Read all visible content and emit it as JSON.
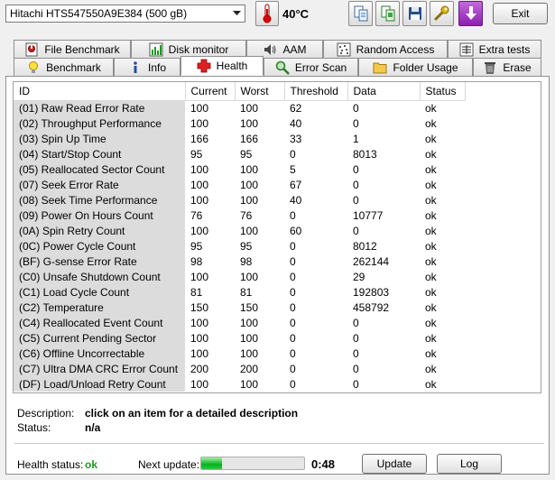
{
  "toolbar": {
    "drive_select": "Hitachi HTS547550A9E384 (500 gB)",
    "temperature": "40°C",
    "exit_label": "Exit"
  },
  "tabs_row1": [
    {
      "label": "File Benchmark",
      "icon": "file-benchmark-icon"
    },
    {
      "label": "Disk monitor",
      "icon": "disk-monitor-icon"
    },
    {
      "label": "AAM",
      "icon": "speaker-icon"
    },
    {
      "label": "Random Access",
      "icon": "random-access-icon"
    },
    {
      "label": "Extra tests",
      "icon": "extra-tests-icon"
    }
  ],
  "tabs_row2": [
    {
      "label": "Benchmark",
      "icon": "lightbulb-icon"
    },
    {
      "label": "Info",
      "icon": "info-icon"
    },
    {
      "label": "Health",
      "icon": "red-cross-icon",
      "active": true
    },
    {
      "label": "Error Scan",
      "icon": "magnifier-icon"
    },
    {
      "label": "Folder Usage",
      "icon": "folder-icon"
    },
    {
      "label": "Erase",
      "icon": "trash-icon"
    }
  ],
  "table": {
    "columns": [
      "ID",
      "Current",
      "Worst",
      "Threshold",
      "Data",
      "Status"
    ],
    "rows": [
      [
        "(01) Raw Read Error Rate",
        "100",
        "100",
        "62",
        "0",
        "ok"
      ],
      [
        "(02) Throughput Performance",
        "100",
        "100",
        "40",
        "0",
        "ok"
      ],
      [
        "(03) Spin Up Time",
        "166",
        "166",
        "33",
        "1",
        "ok"
      ],
      [
        "(04) Start/Stop Count",
        "95",
        "95",
        "0",
        "8013",
        "ok"
      ],
      [
        "(05) Reallocated Sector Count",
        "100",
        "100",
        "5",
        "0",
        "ok"
      ],
      [
        "(07) Seek Error Rate",
        "100",
        "100",
        "67",
        "0",
        "ok"
      ],
      [
        "(08) Seek Time Performance",
        "100",
        "100",
        "40",
        "0",
        "ok"
      ],
      [
        "(09) Power On Hours Count",
        "76",
        "76",
        "0",
        "10777",
        "ok"
      ],
      [
        "(0A) Spin Retry Count",
        "100",
        "100",
        "60",
        "0",
        "ok"
      ],
      [
        "(0C) Power Cycle Count",
        "95",
        "95",
        "0",
        "8012",
        "ok"
      ],
      [
        "(BF) G-sense Error Rate",
        "98",
        "98",
        "0",
        "262144",
        "ok"
      ],
      [
        "(C0) Unsafe Shutdown Count",
        "100",
        "100",
        "0",
        "29",
        "ok"
      ],
      [
        "(C1) Load Cycle Count",
        "81",
        "81",
        "0",
        "192803",
        "ok"
      ],
      [
        "(C2) Temperature",
        "150",
        "150",
        "0",
        "458792",
        "ok"
      ],
      [
        "(C4) Reallocated Event Count",
        "100",
        "100",
        "0",
        "0",
        "ok"
      ],
      [
        "(C5) Current Pending Sector",
        "100",
        "100",
        "0",
        "0",
        "ok"
      ],
      [
        "(C6) Offline Uncorrectable",
        "100",
        "100",
        "0",
        "0",
        "ok"
      ],
      [
        "(C7) Ultra DMA CRC Error Count",
        "200",
        "200",
        "0",
        "0",
        "ok"
      ],
      [
        "(DF) Load/Unload Retry Count",
        "100",
        "100",
        "0",
        "0",
        "ok"
      ]
    ]
  },
  "description": {
    "label": "Description:",
    "value": "click on an item for a detailed description",
    "status_label": "Status:",
    "status_value": "n/a"
  },
  "footer": {
    "health_label": "Health status:",
    "health_value": "ok",
    "next_update_label": "Next update:",
    "next_update_progress": 0.2,
    "timer": "0:48",
    "update_label": "Update",
    "log_label": "Log"
  },
  "colors": {
    "health_ok": "#1aa01a",
    "progress_fill": "#06b025"
  }
}
